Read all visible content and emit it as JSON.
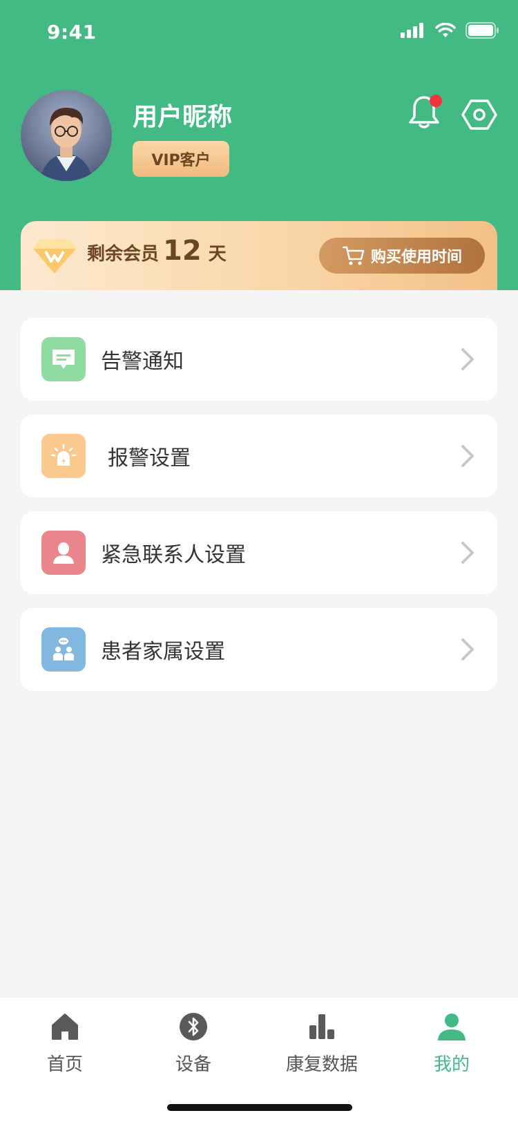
{
  "status_bar": {
    "time": "9:41"
  },
  "profile": {
    "nickname": "用户昵称",
    "vip_label": "VIP客户"
  },
  "membership": {
    "label": "剩余会员",
    "days": "12",
    "unit": "天",
    "buy_label": "购买使用时间"
  },
  "menu": [
    {
      "label": "告警通知",
      "icon": "message-icon",
      "color": "#8fdba1"
    },
    {
      "label": "报警设置",
      "icon": "alarm-light-icon",
      "color": "#f9c98d"
    },
    {
      "label": "紧急联系人设置",
      "icon": "contact-person-icon",
      "color": "#e9868c"
    },
    {
      "label": "患者家属设置",
      "icon": "family-icon",
      "color": "#82b8df"
    }
  ],
  "tabs": [
    {
      "label": "首页",
      "icon": "home-icon"
    },
    {
      "label": "设备",
      "icon": "bluetooth-icon"
    },
    {
      "label": "康复数据",
      "icon": "bar-chart-icon"
    },
    {
      "label": "我的",
      "icon": "person-icon",
      "active": true
    }
  ],
  "colors": {
    "brand_green": "#43b984",
    "notification_dot": "#f5333f",
    "gold_text": "#6b4524"
  }
}
